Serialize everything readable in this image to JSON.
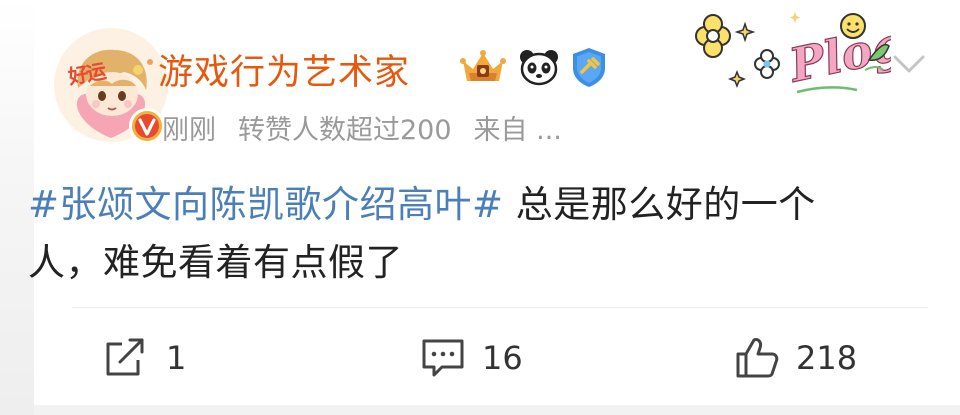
{
  "post": {
    "author": {
      "username": "游戏行为艺术家",
      "avatar_tag": "好运",
      "badges": [
        "crown-badge-icon",
        "panda-badge-icon",
        "shield-badge-icon"
      ]
    },
    "meta": {
      "time": "刚刚",
      "reposts_info": "转赞人数超过200",
      "source": "来自 ..."
    },
    "sticker": "Plog",
    "hashtag": "#张颂文向陈凯歌介绍高叶#",
    "text_line1": " 总是那么好的一个",
    "text_line2": "人，难免看着有点假了",
    "actions": {
      "repost_count": "1",
      "comment_count": "16",
      "like_count": "218"
    }
  },
  "colors": {
    "username": "#e8580c",
    "hashtag": "#4a7fb8",
    "meta": "#9a9a9a",
    "verified": "#e8492f"
  }
}
